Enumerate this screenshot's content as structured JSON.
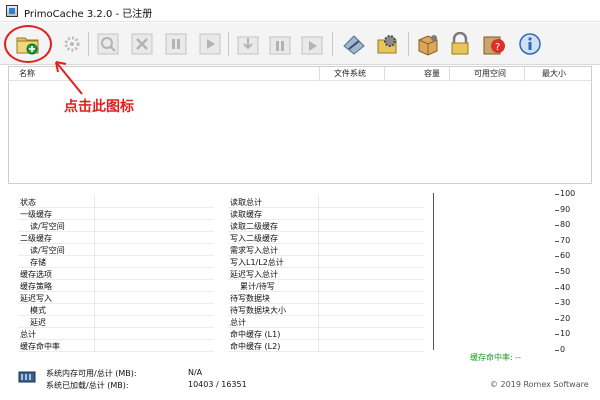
{
  "window": {
    "title": "PrimoCache 3.2.0 - 已注册"
  },
  "toolbar": {
    "buttons": [
      {
        "icon": "create-cache-icon"
      },
      {
        "icon": "gear-cache-icon"
      },
      {
        "icon": "search-icon"
      },
      {
        "icon": "delete-icon"
      },
      {
        "icon": "pause-icon"
      },
      {
        "icon": "play-icon"
      },
      {
        "icon": "download-icon"
      },
      {
        "icon": "pause-group-icon"
      },
      {
        "icon": "play-group-icon"
      },
      {
        "icon": "wrench-icon"
      },
      {
        "icon": "settings-gear-icon"
      },
      {
        "icon": "package-icon"
      },
      {
        "icon": "lock-icon"
      },
      {
        "icon": "help-icon"
      },
      {
        "icon": "info-icon"
      }
    ]
  },
  "list": {
    "columns": [
      "名称",
      "文件系统",
      "容量",
      "可用空间",
      "最大小"
    ]
  },
  "annotation": {
    "text": "点击此图标",
    "color": "#e02020"
  },
  "stats_left": [
    "状态",
    "一级缓存",
    "读/写空间",
    "二级缓存",
    "读/写空间",
    "存储",
    "缓存选项",
    "缓存策略",
    "延迟写入",
    "模式",
    "延迟",
    "总计",
    "缓存命中率"
  ],
  "stats_right": [
    "读取总计",
    "读取缓存",
    "读取二级缓存",
    "写入二级缓存",
    "需求写入总计",
    "写入L1/L2总计",
    "延迟写入总计",
    "累计/待写",
    "待写数据块",
    "待写数据块大小",
    "总计",
    "命中缓存 (L1)",
    "命中缓存 (L2)"
  ],
  "graph": {
    "y_labels": [
      "100",
      "90",
      "80",
      "70",
      "60",
      "50",
      "40",
      "30",
      "20",
      "10",
      "0"
    ],
    "rate_label": "缓存命中率: --"
  },
  "bottom": {
    "line1_label": "系统内存可用/总计 (MB):",
    "line1_value": "N/A",
    "line2_label": "系统已加载/总计 (MB):",
    "line2_value": "10403 / 16351"
  },
  "footer": {
    "text": "© 2019 Romex Software"
  },
  "colors": {
    "accent_red": "#e02020",
    "rate_green": "#1a9a1a"
  }
}
